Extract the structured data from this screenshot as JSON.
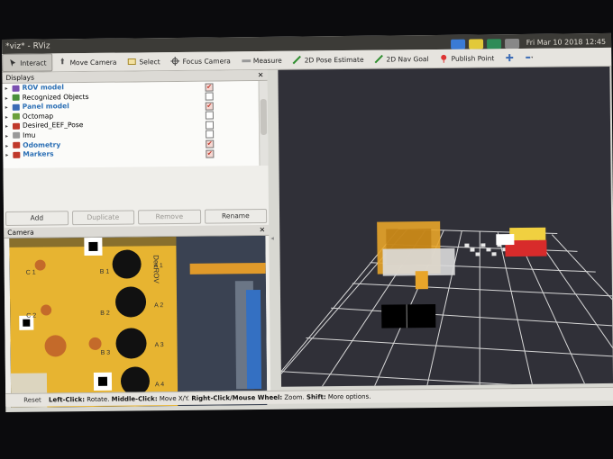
{
  "window": {
    "title": "*viz* - RViz",
    "clock": "Fri Mar 10 2018 12:45"
  },
  "toolbar": {
    "items": [
      "Interact",
      "Move Camera",
      "Select",
      "Focus Camera",
      "Measure",
      "2D Pose Estimate",
      "2D Nav Goal",
      "Publish Point"
    ],
    "active": "Interact"
  },
  "displays": {
    "title": "Displays",
    "items": [
      {
        "label": "ROV model",
        "blue": true,
        "checked": true
      },
      {
        "label": "Recognized Objects",
        "blue": false,
        "checked": false
      },
      {
        "label": "Panel model",
        "blue": true,
        "checked": true
      },
      {
        "label": "Octomap",
        "blue": false,
        "checked": false
      },
      {
        "label": "Desired_EEF_Pose",
        "blue": false,
        "checked": false
      },
      {
        "label": "Imu",
        "blue": false,
        "checked": false
      },
      {
        "label": "Odometry",
        "blue": true,
        "checked": true
      },
      {
        "label": "Markers",
        "blue": true,
        "checked": true
      }
    ],
    "buttons": [
      "Add",
      "Duplicate",
      "Remove",
      "Rename"
    ]
  },
  "camera": {
    "title": "Camera",
    "panel_label": "DexROV",
    "tags": [
      "C 1",
      "C 2",
      "B 1",
      "B 2",
      "B 3",
      "A 1",
      "A 2",
      "A 3",
      "A 4"
    ]
  },
  "status": {
    "reset": "Reset",
    "hint_parts": [
      "Left-Click:",
      " Rotate. ",
      "Middle-Click:",
      " Move X/Y. ",
      "Right-Click/Mouse Wheel:",
      " Zoom. ",
      "Shift:",
      " More options."
    ]
  },
  "colors": {
    "grid": "#d8d8d8",
    "robot": "#e8a52a",
    "marker": "#d82b2b"
  }
}
